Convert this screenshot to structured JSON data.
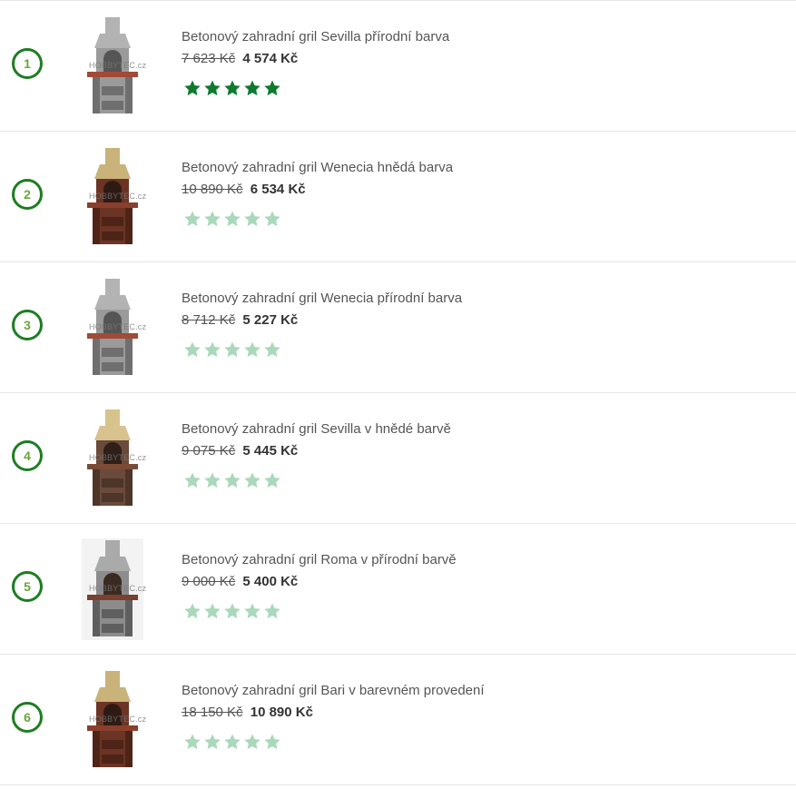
{
  "colors": {
    "rank_border": "#1e7d22",
    "rank_text": "#6aa63a",
    "star_full": "#0d7a2e",
    "star_empty": "#aad8bb"
  },
  "products": [
    {
      "rank": "1",
      "title": "Betonový zahradní gril Sevilla přírodní barva",
      "old_price": "7 623 Kč",
      "new_price": "4 574 Kč",
      "rating": 5,
      "variant": "grey",
      "watermark": "HOBBYTEC.cz"
    },
    {
      "rank": "2",
      "title": "Betonový zahradní gril Wenecia hnědá barva",
      "old_price": "10 890 Kč",
      "new_price": "6 534 Kč",
      "rating": 0,
      "variant": "brown",
      "watermark": "HOBBYTEC.cz"
    },
    {
      "rank": "3",
      "title": "Betonový zahradní gril Wenecia přírodní barva",
      "old_price": "8 712 Kč",
      "new_price": "5 227 Kč",
      "rating": 0,
      "variant": "grey",
      "watermark": "HOBBYTEC.cz"
    },
    {
      "rank": "4",
      "title": "Betonový zahradní gril Sevilla v hnědé barvě",
      "old_price": "9 075 Kč",
      "new_price": "5 445 Kč",
      "rating": 0,
      "variant": "brown-light",
      "watermark": "HOBBYTEC.cz"
    },
    {
      "rank": "5",
      "title": "Betonový zahradní gril Roma v přírodní barvě",
      "old_price": "9 000 Kč",
      "new_price": "5 400 Kč",
      "rating": 0,
      "variant": "roma",
      "watermark": "HOBBYTEC.cz"
    },
    {
      "rank": "6",
      "title": "Betonový zahradní gril Bari v barevném provedení",
      "old_price": "18 150 Kč",
      "new_price": "10 890 Kč",
      "rating": 0,
      "variant": "brown",
      "watermark": "HOBBYTEC.cz"
    }
  ]
}
